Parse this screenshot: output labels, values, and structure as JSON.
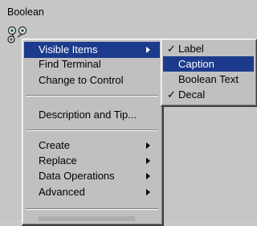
{
  "control_label": "Boolean",
  "main_menu": {
    "items": [
      {
        "label": "Visible Items",
        "submenu": true,
        "highlighted": true
      },
      {
        "label": "Find Terminal",
        "submenu": false
      },
      {
        "label": "Change to Control",
        "submenu": false
      },
      {
        "separator": true
      },
      {
        "label": "Description and Tip...",
        "submenu": false
      },
      {
        "separator": true
      },
      {
        "label": "Create",
        "submenu": true
      },
      {
        "label": "Replace",
        "submenu": true
      },
      {
        "label": "Data Operations",
        "submenu": true
      },
      {
        "label": "Advanced",
        "submenu": true
      },
      {
        "separator": true
      }
    ]
  },
  "sub_menu": {
    "items": [
      {
        "label": "Label",
        "checked": true
      },
      {
        "label": "Caption",
        "checked": false,
        "highlighted": true
      },
      {
        "label": "Boolean Text",
        "checked": false
      },
      {
        "label": "Decal",
        "checked": true
      }
    ],
    "check_glyph": "✓"
  },
  "colors": {
    "highlight": "#1c3b8c",
    "menu_bg": "#c0c0c0",
    "panel_bg": "#c6c6c6"
  }
}
